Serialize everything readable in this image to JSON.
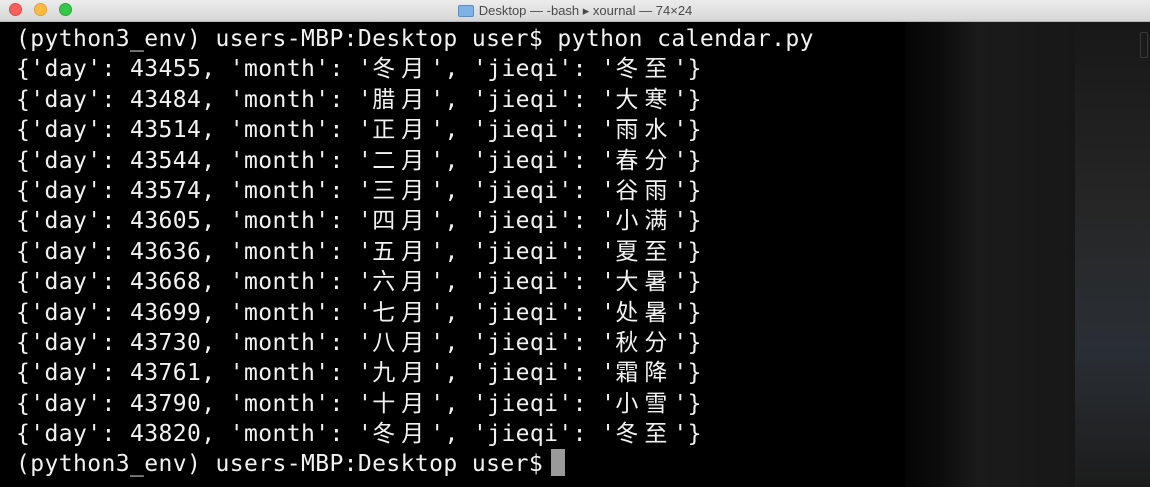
{
  "window": {
    "title": "Desktop — -bash ▸ xournal — 74×24"
  },
  "terminal": {
    "command_line": "(python3_env) users-MBP:Desktop user$ python calendar.py",
    "rows": [
      {
        "day": "43455",
        "month": "冬月",
        "jieqi": "冬至"
      },
      {
        "day": "43484",
        "month": "腊月",
        "jieqi": "大寒"
      },
      {
        "day": "43514",
        "month": "正月",
        "jieqi": "雨水"
      },
      {
        "day": "43544",
        "month": "二月",
        "jieqi": "春分"
      },
      {
        "day": "43574",
        "month": "三月",
        "jieqi": "谷雨"
      },
      {
        "day": "43605",
        "month": "四月",
        "jieqi": "小满"
      },
      {
        "day": "43636",
        "month": "五月",
        "jieqi": "夏至"
      },
      {
        "day": "43668",
        "month": "六月",
        "jieqi": "大暑"
      },
      {
        "day": "43699",
        "month": "七月",
        "jieqi": "处暑"
      },
      {
        "day": "43730",
        "month": "八月",
        "jieqi": "秋分"
      },
      {
        "day": "43761",
        "month": "九月",
        "jieqi": "霜降"
      },
      {
        "day": "43790",
        "month": "十月",
        "jieqi": "小雪"
      },
      {
        "day": "43820",
        "month": "冬月",
        "jieqi": "冬至"
      }
    ],
    "prompt": "(python3_env) users-MBP:Desktop user$"
  },
  "colors": {
    "text": "#f2f2f2",
    "background": "#000000",
    "cursor": "#9a9a9a"
  }
}
